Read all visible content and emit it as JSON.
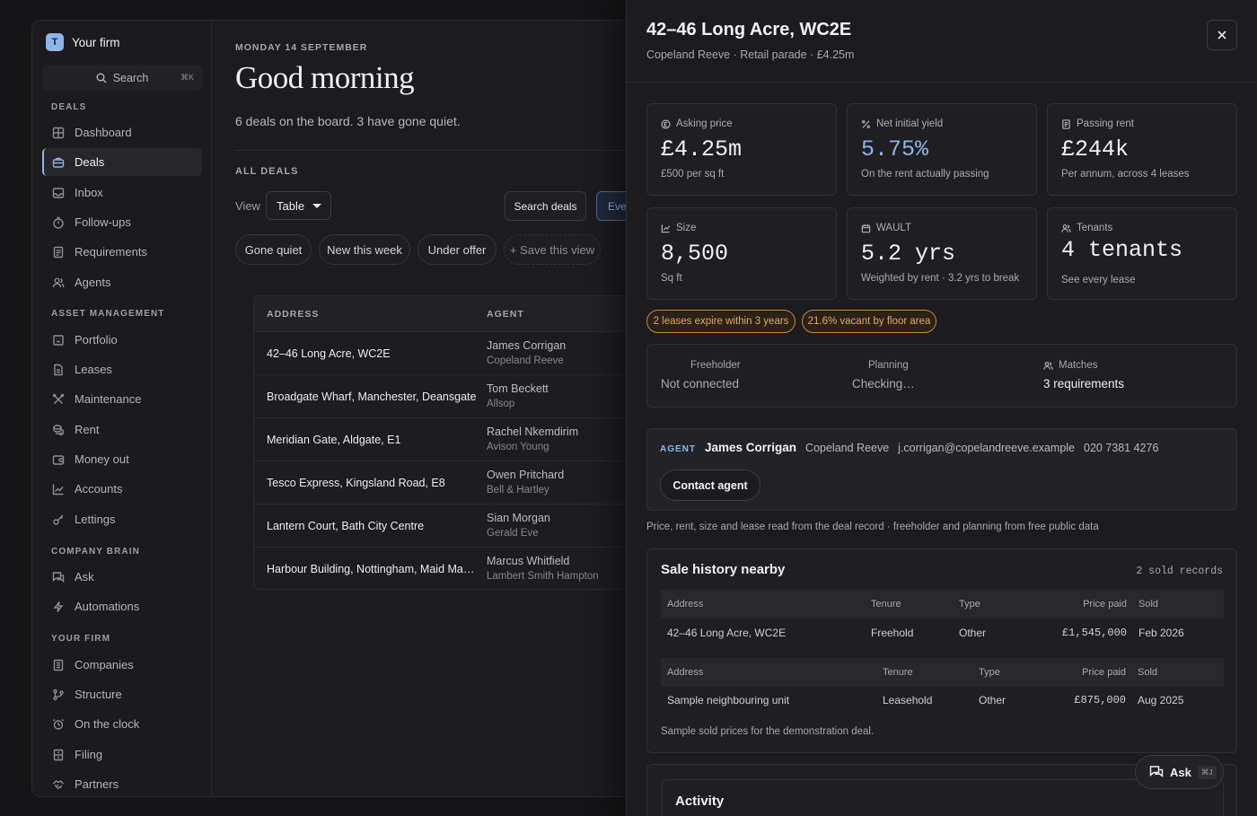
{
  "firm": {
    "initial": "T",
    "name": "Your firm"
  },
  "search": {
    "label": "Search",
    "shortcut": "⌘K"
  },
  "sidebar": {
    "sections": [
      {
        "label": "DEALS",
        "items": [
          "Dashboard",
          "Deals",
          "Inbox",
          "Follow-ups",
          "Requirements",
          "Agents"
        ]
      },
      {
        "label": "ASSET MANAGEMENT",
        "items": [
          "Portfolio",
          "Leases",
          "Maintenance",
          "Rent",
          "Money out",
          "Accounts",
          "Lettings"
        ]
      },
      {
        "label": "COMPANY BRAIN",
        "items": [
          "Ask",
          "Automations"
        ]
      },
      {
        "label": "YOUR FIRM",
        "items": [
          "Companies",
          "Structure",
          "On the clock",
          "Filing",
          "Partners"
        ]
      }
    ],
    "active": "Deals"
  },
  "main": {
    "date": "MONDAY 14 SEPTEMBER",
    "greeting": "Good morning",
    "summary": "6 deals on the board. 3 have gone quiet.",
    "all_deals_label": "ALL DEALS",
    "view_label": "View",
    "view_value": "Table",
    "search_deals": "Search deals",
    "partial_button": "Ever",
    "chips": [
      "Gone quiet",
      "New this week",
      "Under offer",
      "+ Save this view"
    ],
    "table": {
      "headers": [
        "ADDRESS",
        "AGENT"
      ],
      "rows": [
        {
          "address": "42–46 Long Acre, WC2E",
          "agent": "James Corrigan",
          "agency": "Copeland Reeve"
        },
        {
          "address": "Broadgate Wharf, Manchester, Deansgate",
          "agent": "Tom Beckett",
          "agency": "Allsop"
        },
        {
          "address": "Meridian Gate, Aldgate, E1",
          "agent": "Rachel Nkemdirim",
          "agency": "Avison Young"
        },
        {
          "address": "Tesco Express, Kingsland Road, E8",
          "agent": "Owen Pritchard",
          "agency": "Bell & Hartley"
        },
        {
          "address": "Lantern Court, Bath City Centre",
          "agent": "Sian Morgan",
          "agency": "Gerald Eve"
        },
        {
          "address": "Harbour Building, Nottingham, Maid Marian Way",
          "agent": "Marcus Whitfield",
          "agency": "Lambert Smith Hampton"
        }
      ]
    }
  },
  "panel": {
    "title": "42–46 Long Acre, WC2E",
    "subtitle": "Copeland Reeve · Retail parade · £4.25m",
    "stats": [
      {
        "label": "Asking price",
        "value": "£4.25m",
        "note": "£500 per sq ft",
        "icon": "coin-icon"
      },
      {
        "label": "Net initial yield",
        "value": "5.75%",
        "note": "On the rent actually passing",
        "icon": "percent-icon"
      },
      {
        "label": "Passing rent",
        "value": "£244k",
        "note": "Per annum, across 4 leases",
        "icon": "receipt-icon"
      },
      {
        "label": "Size",
        "value": "8,500",
        "note": "Sq ft",
        "icon": "chart-icon"
      },
      {
        "label": "WAULT",
        "value": "5.2 yrs",
        "note": "Weighted by rent · 3.2 yrs to break",
        "icon": "calendar-icon"
      },
      {
        "label": "Tenants",
        "value": "4 tenants",
        "note": "See every lease",
        "icon": "people-icon"
      }
    ],
    "warnings": [
      "2 leases expire within 3 years",
      "21.6% vacant by floor area"
    ],
    "info": [
      {
        "label": "Freeholder",
        "value": "Not connected"
      },
      {
        "label": "Planning",
        "value": "Checking…"
      },
      {
        "label": "Matches",
        "value": "3 requirements"
      }
    ],
    "agent": {
      "tag": "AGENT",
      "name": "James Corrigan",
      "company": "Copeland Reeve",
      "email": "j.corrigan@copelandreeve.example",
      "phone": "020 7381 4276",
      "contact_label": "Contact agent"
    },
    "source_note": "Price, rent, size and lease read from the deal record · freeholder and planning from free public data",
    "sale_history": {
      "title": "Sale history nearby",
      "count": "2 sold records",
      "headers": [
        "Address",
        "Tenure",
        "Type",
        "Price paid",
        "Sold"
      ],
      "rows": [
        {
          "address": "42–46 Long Acre, WC2E",
          "tenure": "Freehold",
          "type": "Other",
          "price": "£1,545,000",
          "sold": "Feb 2026"
        },
        {
          "address": "Sample neighbouring unit",
          "tenure": "Leasehold",
          "type": "Other",
          "price": "£875,000",
          "sold": "Aug 2025"
        }
      ],
      "note": "Sample sold prices for the demonstration deal."
    },
    "activity_title": "Activity",
    "ask": {
      "label": "Ask",
      "shortcut": "⌘J"
    }
  }
}
